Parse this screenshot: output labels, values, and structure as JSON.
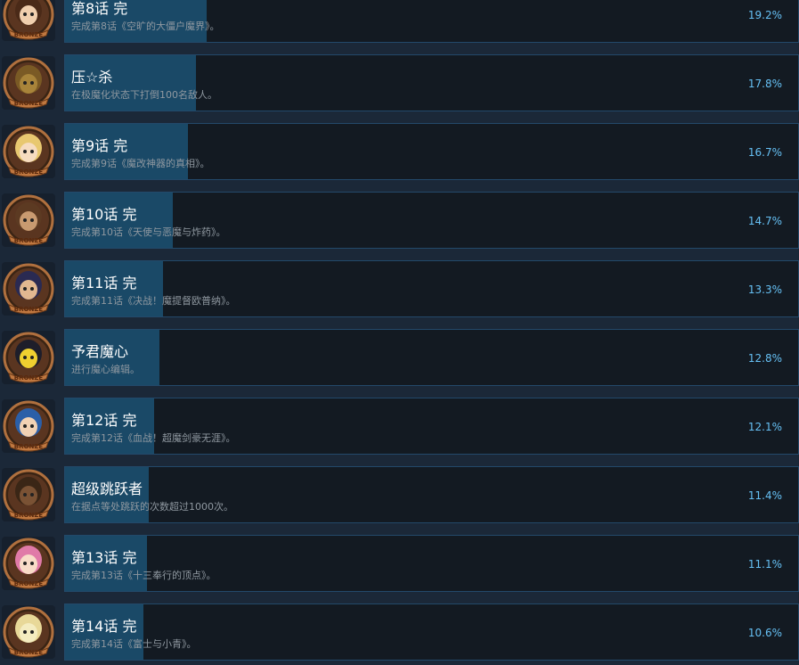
{
  "achievements": [
    {
      "title": "第8话 完",
      "desc": "完成第8话《空旷的大僵户魔界》。",
      "percent": "19.2%",
      "pct_value": 19.2,
      "icon": "bronze-badge-twin-girls-icon",
      "hair": "#4a2a18",
      "skin": "#f0cfae"
    },
    {
      "title": "压☆杀",
      "desc": "在极魔化状态下打倒100名敌人。",
      "percent": "17.8%",
      "pct_value": 17.8,
      "icon": "bronze-badge-rock-monster-icon",
      "hair": "#7a5a25",
      "skin": "#a8843a"
    },
    {
      "title": "第9话 完",
      "desc": "完成第9话《魔改神器的真相》。",
      "percent": "16.7%",
      "pct_value": 16.7,
      "icon": "bronze-badge-blonde-glasses-girl-icon",
      "hair": "#e8c870",
      "skin": "#f6dcc0"
    },
    {
      "title": "第10话 完",
      "desc": "完成第10话《天使与恶魔与炸药》。",
      "percent": "14.7%",
      "pct_value": 14.7,
      "icon": "bronze-badge-brown-creature-icon",
      "hair": "#5c3a22",
      "skin": "#c89a70"
    },
    {
      "title": "第11话 完",
      "desc": "完成第11话《决战！魔提督欧普纳》。",
      "percent": "13.3%",
      "pct_value": 13.3,
      "icon": "bronze-badge-pirate-captain-icon",
      "hair": "#2a2a52",
      "skin": "#e2b890"
    },
    {
      "title": "予君魔心",
      "desc": "进行魔心编辑。",
      "percent": "12.8%",
      "pct_value": 12.8,
      "icon": "bronze-badge-demon-heart-icon",
      "hair": "#1e1e2a",
      "skin": "#f0d030"
    },
    {
      "title": "第12话 完",
      "desc": "完成第12话《血战！超魔剑豪无涯》。",
      "percent": "12.1%",
      "pct_value": 12.1,
      "icon": "bronze-badge-blue-hair-swordsman-icon",
      "hair": "#2b5fa8",
      "skin": "#f2d2b4"
    },
    {
      "title": "超级跳跃者",
      "desc": "在据点等处跳跃的次数超过1000次。",
      "percent": "11.4%",
      "pct_value": 11.4,
      "icon": "bronze-badge-bull-icon",
      "hair": "#3a2616",
      "skin": "#7a5234"
    },
    {
      "title": "第13话 完",
      "desc": "完成第13话《十三奉行的顶点》。",
      "percent": "11.1%",
      "pct_value": 11.1,
      "icon": "bronze-badge-pink-hair-girl-icon",
      "hair": "#e07aa8",
      "skin": "#f8dcc8"
    },
    {
      "title": "第14话 完",
      "desc": "完成第14话《富士与小青》。",
      "percent": "10.6%",
      "pct_value": 10.6,
      "icon": "bronze-badge-yellow-bird-icon",
      "hair": "#e8d898",
      "skin": "#f4ecc0"
    }
  ],
  "badge_label": "BRONZE",
  "colors": {
    "background": "#1b2838",
    "card": "#131a22",
    "card_border": "#23496a",
    "progress_fill": "#1a4967",
    "percent_text": "#66c0f4",
    "bronze": "#b0703e"
  }
}
